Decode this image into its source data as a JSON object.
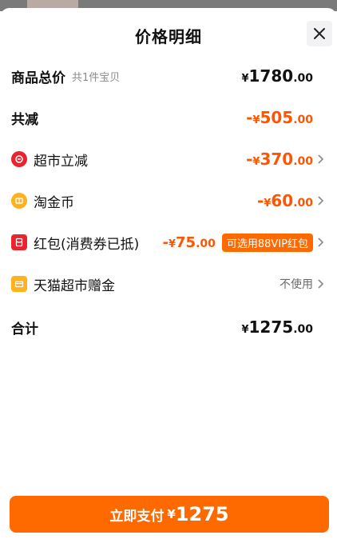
{
  "header": {
    "title": "价格明细",
    "close_icon": "close-icon"
  },
  "rows": {
    "goods_total": {
      "label": "商品总价",
      "sub": "共1件宝贝",
      "currency": "¥",
      "int": "1780",
      "dec": ".00"
    },
    "total_discount": {
      "label": "共减",
      "prefix": "-",
      "currency": "¥",
      "int": "505",
      "dec": ".00"
    },
    "market_discount": {
      "label": "超市立减",
      "icon": "coupon-red-icon",
      "prefix": "-",
      "currency": "¥",
      "int": "370",
      "dec": ".00"
    },
    "taojinbi": {
      "label": "淘金币",
      "icon": "coin-icon",
      "prefix": "-",
      "currency": "¥",
      "int": "60",
      "dec": ".00"
    },
    "red_packet": {
      "label": "红包(消费券已抵)",
      "icon": "red-packet-icon",
      "prefix": "-",
      "currency": "¥",
      "int": "75",
      "dec": ".00",
      "badge": "可选用88VIP红包"
    },
    "gift": {
      "label": "天猫超市赠金",
      "icon": "gift-card-icon",
      "status": "不使用"
    },
    "sum": {
      "label": "合计",
      "currency": "¥",
      "int": "1275",
      "dec": ".00"
    }
  },
  "footer": {
    "pay_label": "立即支付",
    "currency": "¥",
    "amount": "1275"
  },
  "colors": {
    "accent": "#ff5500",
    "button": "#ff6a00"
  }
}
